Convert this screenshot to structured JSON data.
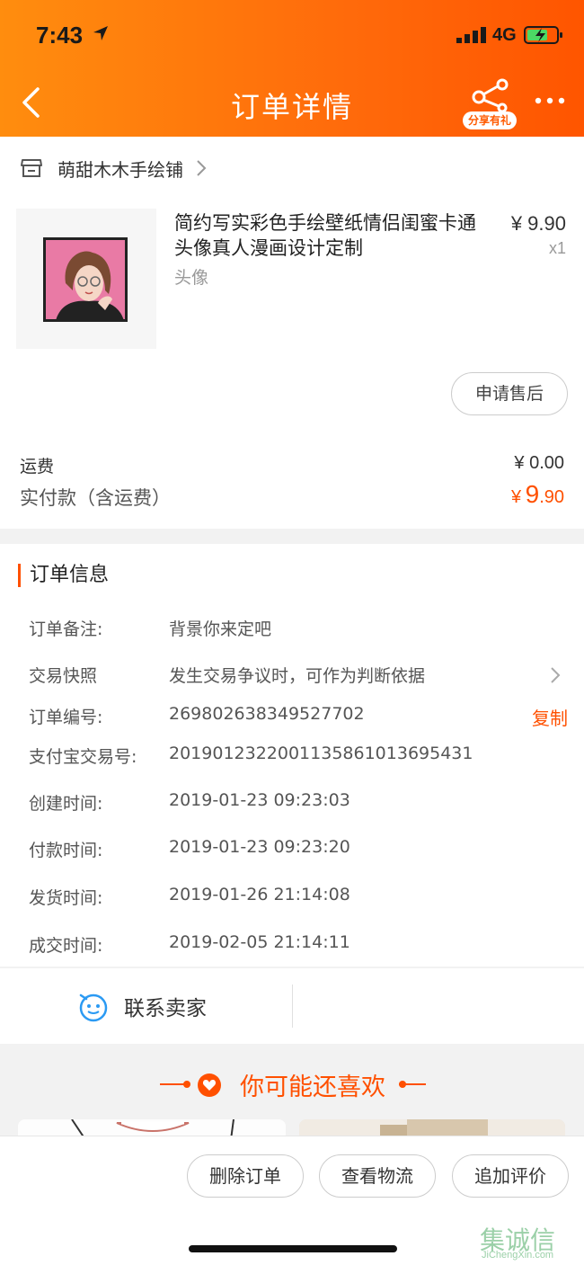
{
  "status_bar": {
    "time": "7:43",
    "network": "4G"
  },
  "nav": {
    "title": "订单详情",
    "share_tag": "分享有礼"
  },
  "shop": {
    "name": "萌甜木木手绘铺"
  },
  "product": {
    "name": "简约写实彩色手绘壁纸情侣闺蜜卡通头像真人漫画设计定制",
    "sku": "头像",
    "price": "¥ 9.90",
    "qty": "x1",
    "aftersale_label": "申请售后"
  },
  "fees": {
    "shipping_label": "运费",
    "shipping_value": "¥ 0.00",
    "paid_label": "实付款（含运费）",
    "paid_symbol": "¥",
    "paid_int": "9",
    "paid_dec": ".90"
  },
  "order_info": {
    "title": "订单信息",
    "rows": [
      {
        "key": "订单备注:",
        "value": "背景你来定吧"
      },
      {
        "key": "交易快照",
        "value": "发生交易争议时，可作为判断依据"
      },
      {
        "key": "订单编号:",
        "value": "269802638349527702",
        "action": "复制"
      },
      {
        "key": "支付宝交易号:",
        "value": "2019012322001135861013695431"
      },
      {
        "key": "创建时间:",
        "value": "2019-01-23 09:23:03"
      },
      {
        "key": "付款时间:",
        "value": "2019-01-23 09:23:20"
      },
      {
        "key": "发货时间:",
        "value": "2019-01-26 21:14:08"
      },
      {
        "key": "成交时间:",
        "value": "2019-02-05 21:14:11"
      }
    ]
  },
  "contact": {
    "label": "联系卖家"
  },
  "recommend": {
    "title": "你可能还喜欢"
  },
  "bottom_actions": [
    {
      "label": "删除订单"
    },
    {
      "label": "查看物流"
    },
    {
      "label": "追加评价"
    }
  ],
  "watermark": {
    "cn": "集诚信",
    "en": "JiChengXin.com"
  },
  "colors": {
    "accent": "#ff5000",
    "header_start": "#ff8d0e",
    "header_end": "#ff5500"
  }
}
